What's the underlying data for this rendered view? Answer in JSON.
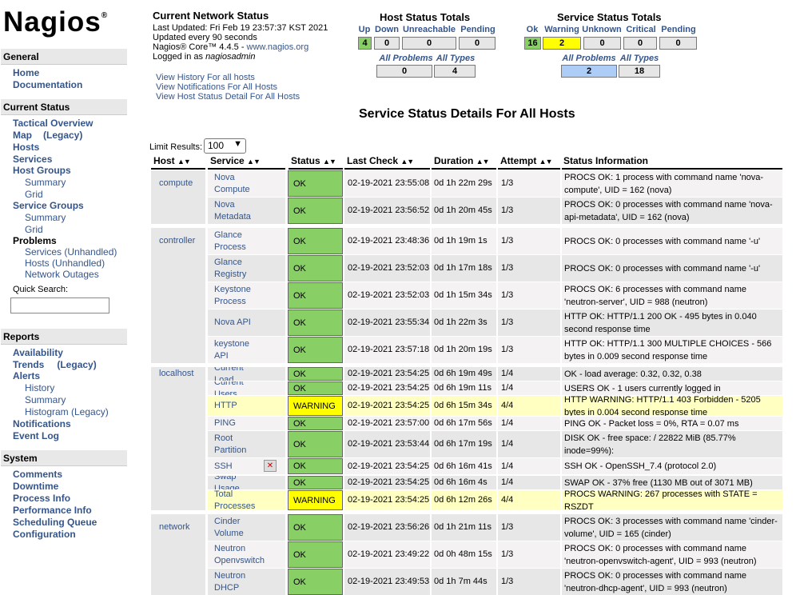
{
  "brand": {
    "name": "Nagios",
    "mark": "®"
  },
  "sidebar": {
    "general": "General",
    "general_items": [
      "Home",
      "Documentation"
    ],
    "current_status": "Current Status",
    "tactical": "Tactical Overview",
    "map": "Map",
    "map_legacy": "(Legacy)",
    "hosts": "Hosts",
    "services": "Services",
    "host_groups": "Host Groups",
    "hg_summary": "Summary",
    "hg_grid": "Grid",
    "service_groups": "Service Groups",
    "sg_summary": "Summary",
    "sg_grid": "Grid",
    "problems": "Problems",
    "p_services": "Services",
    "p_services_u": "(Unhandled)",
    "p_hosts": "Hosts",
    "p_hosts_u": "(Unhandled)",
    "p_outages": "Network Outages",
    "quick_search": "Quick Search:",
    "reports": "Reports",
    "availability": "Availability",
    "trends": "Trends",
    "trends_legacy": "(Legacy)",
    "alerts": "Alerts",
    "a_history": "History",
    "a_summary": "Summary",
    "a_histogram": "Histogram (Legacy)",
    "notifications": "Notifications",
    "event_log": "Event Log",
    "system": "System",
    "system_items": [
      "Comments",
      "Downtime",
      "Process Info",
      "Performance Info",
      "Scheduling Queue",
      "Configuration"
    ]
  },
  "header": {
    "title": "Current Network Status",
    "updated": "Last Updated: Fri Feb 19 23:57:37 KST 2021",
    "interval": "Updated every 90 seconds",
    "version": "Nagios® Core™ 4.4.5 - ",
    "site": "www.nagios.org",
    "logged": "Logged in as ",
    "user": "nagiosadmin",
    "links": [
      "View History For all hosts",
      "View Notifications For All Hosts",
      "View Host Status Detail For All Hosts"
    ]
  },
  "host_totals": {
    "title": "Host Status Totals",
    "labels": [
      "Up",
      "Down",
      "Unreachable",
      "Pending"
    ],
    "values": [
      "4",
      "0",
      "0",
      "0"
    ],
    "all_problems": "All Problems",
    "all_types": "All Types",
    "problems_value": "0",
    "types_value": "4"
  },
  "service_totals": {
    "title": "Service Status Totals",
    "labels": [
      "Ok",
      "Warning",
      "Unknown",
      "Critical",
      "Pending"
    ],
    "values": [
      "16",
      "2",
      "0",
      "0",
      "0"
    ],
    "all_problems": "All Problems",
    "all_types": "All Types",
    "problems_value": "2",
    "types_value": "18"
  },
  "colors": {
    "ok": "#88d066",
    "warning": "#ffff00",
    "up": "#88d066",
    "link": "#34558b"
  },
  "page_title": "Service Status Details For All Hosts",
  "limit": {
    "label": "Limit Results:",
    "value": "100"
  },
  "columns": [
    "Host",
    "Service",
    "Status",
    "Last Check",
    "Duration",
    "Attempt",
    "Status Information"
  ],
  "rows": [
    {
      "host": "compute",
      "service": "Nova Compute",
      "status": "OK",
      "last": "02-19-2021 23:55:08",
      "dur": "0d 1h 22m 29s",
      "att": "1/3",
      "info": "PROCS OK: 1 process with command name 'nova-compute', UID = 162 (nova)"
    },
    {
      "host": "",
      "service": "Nova Metadata",
      "status": "OK",
      "last": "02-19-2021 23:56:52",
      "dur": "0d 1h 20m 45s",
      "att": "1/3",
      "info": "PROCS OK: 0 processes with command name 'nova-api-metadata', UID = 162 (nova)"
    },
    {
      "host": "controller",
      "service": "Glance Process",
      "status": "OK",
      "last": "02-19-2021 23:48:36",
      "dur": "0d 1h 19m 1s",
      "att": "1/3",
      "info": "PROCS OK: 0 processes with command name '-u'"
    },
    {
      "host": "",
      "service": "Glance Registry",
      "status": "OK",
      "last": "02-19-2021 23:52:03",
      "dur": "0d 1h 17m 18s",
      "att": "1/3",
      "info": "PROCS OK: 0 processes with command name '-u'"
    },
    {
      "host": "",
      "service": "Keystone Process",
      "status": "OK",
      "last": "02-19-2021 23:52:03",
      "dur": "0d 1h 15m 34s",
      "att": "1/3",
      "info": "PROCS OK: 6 processes with command name 'neutron-server', UID = 988 (neutron)"
    },
    {
      "host": "",
      "service": "Nova API",
      "status": "OK",
      "last": "02-19-2021 23:55:34",
      "dur": "0d 1h 22m 3s",
      "att": "1/3",
      "info": "HTTP OK: HTTP/1.1 200 OK - 495 bytes in 0.040 second response time"
    },
    {
      "host": "",
      "service": "keystone API",
      "status": "OK",
      "last": "02-19-2021 23:57:18",
      "dur": "0d 1h 20m 19s",
      "att": "1/3",
      "info": "HTTP OK: HTTP/1.1 300 MULTIPLE CHOICES - 566 bytes in 0.009 second response time"
    },
    {
      "host": "localhost",
      "service": "Current Load",
      "status": "OK",
      "last": "02-19-2021 23:54:25",
      "dur": "0d 6h 19m 49s",
      "att": "1/4",
      "info": "OK - load average: 0.32, 0.32, 0.38"
    },
    {
      "host": "",
      "service": "Current Users",
      "status": "OK",
      "last": "02-19-2021 23:54:25",
      "dur": "0d 6h 19m 11s",
      "att": "1/4",
      "info": "USERS OK - 1 users currently logged in"
    },
    {
      "host": "",
      "service": "HTTP",
      "status": "WARNING",
      "last": "02-19-2021 23:54:25",
      "dur": "0d 6h 15m 34s",
      "att": "4/4",
      "info": "HTTP WARNING: HTTP/1.1 403 Forbidden - 5205 bytes in 0.004 second response time"
    },
    {
      "host": "",
      "service": "PING",
      "status": "OK",
      "last": "02-19-2021 23:57:00",
      "dur": "0d 6h 17m 56s",
      "att": "1/4",
      "info": "PING OK - Packet loss = 0%, RTA = 0.07 ms"
    },
    {
      "host": "",
      "service": "Root Partition",
      "status": "OK",
      "last": "02-19-2021 23:53:44",
      "dur": "0d 6h 17m 19s",
      "att": "1/4",
      "info": "DISK OK - free space: / 22822 MiB (85.77% inode=99%):"
    },
    {
      "host": "",
      "service": "SSH",
      "status": "OK",
      "last": "02-19-2021 23:54:25",
      "dur": "0d 6h 16m 41s",
      "att": "1/4",
      "info": "SSH OK - OpenSSH_7.4 (protocol 2.0)"
    },
    {
      "host": "",
      "service": "Swap Usage",
      "status": "OK",
      "last": "02-19-2021 23:54:25",
      "dur": "0d 6h 16m 4s",
      "att": "1/4",
      "info": "SWAP OK - 37% free (1130 MB out of 3071 MB)"
    },
    {
      "host": "",
      "service": "Total Processes",
      "status": "WARNING",
      "last": "02-19-2021 23:54:25",
      "dur": "0d 6h 12m 26s",
      "att": "4/4",
      "info": "PROCS WARNING: 267 processes with STATE = RSZDT"
    },
    {
      "host": "network",
      "service": "Cinder Volume",
      "status": "OK",
      "last": "02-19-2021 23:56:26",
      "dur": "0d 1h 21m 11s",
      "att": "1/3",
      "info": "PROCS OK: 3 processes with command name 'cinder-volume', UID = 165 (cinder)"
    },
    {
      "host": "",
      "service": "Neutron Openvswitch",
      "status": "OK",
      "last": "02-19-2021 23:49:22",
      "dur": "0d 0h 48m 15s",
      "att": "1/3",
      "info": "PROCS OK: 0 processes with command name 'neutron-openvswitch-agent', UID = 993 (neutron)"
    },
    {
      "host": "",
      "service": "Neutron DHCP",
      "status": "OK",
      "last": "02-19-2021 23:49:53",
      "dur": "0d 1h 7m 44s",
      "att": "1/3",
      "info": "PROCS OK: 0 processes with command name 'neutron-dhcp-agent', UID = 993 (neutron)"
    }
  ]
}
